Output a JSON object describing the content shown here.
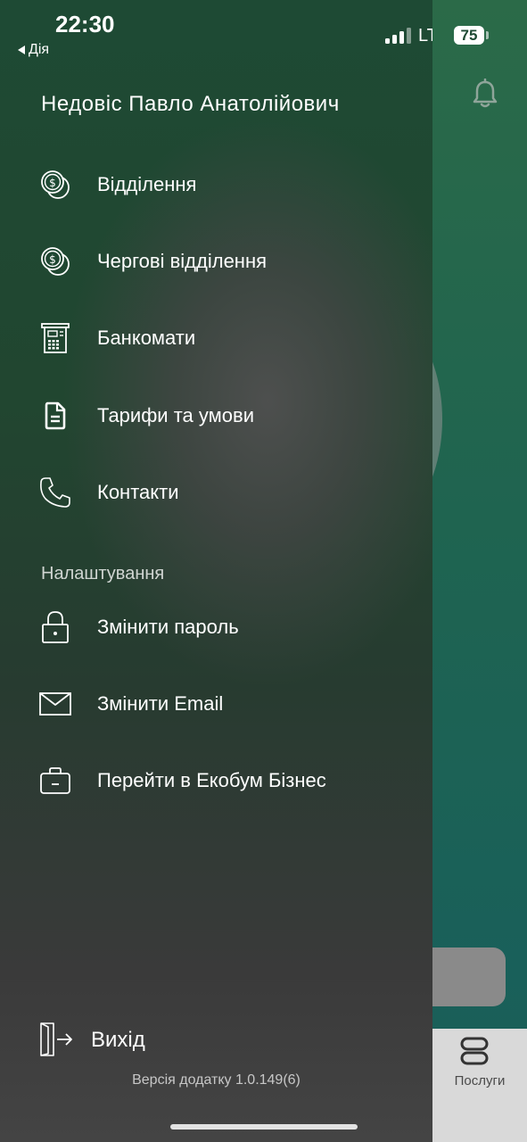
{
  "status_bar": {
    "time": "22:30",
    "back_label": "Дія",
    "network": "LTE",
    "battery": "75"
  },
  "drawer": {
    "user_name": "Недовіс Павло Анатолійович",
    "menu": [
      {
        "label": "Відділення",
        "icon": "coins-icon"
      },
      {
        "label": "Чергові відділення",
        "icon": "coins-icon"
      },
      {
        "label": "Банкомати",
        "icon": "atm-icon"
      },
      {
        "label": "Тарифи та умови",
        "icon": "document-icon"
      },
      {
        "label": "Контакти",
        "icon": "phone-icon"
      }
    ],
    "settings_title": "Налаштування",
    "settings": [
      {
        "label": "Змінити пароль",
        "icon": "lock-icon"
      },
      {
        "label": "Змінити Email",
        "icon": "envelope-icon"
      },
      {
        "label": "Перейти в Екобум Бізнес",
        "icon": "briefcase-icon"
      }
    ],
    "logout_label": "Вихід",
    "version": "Версія додатку 1.0.149(6)"
  },
  "background": {
    "tab_label": "Послуги"
  }
}
